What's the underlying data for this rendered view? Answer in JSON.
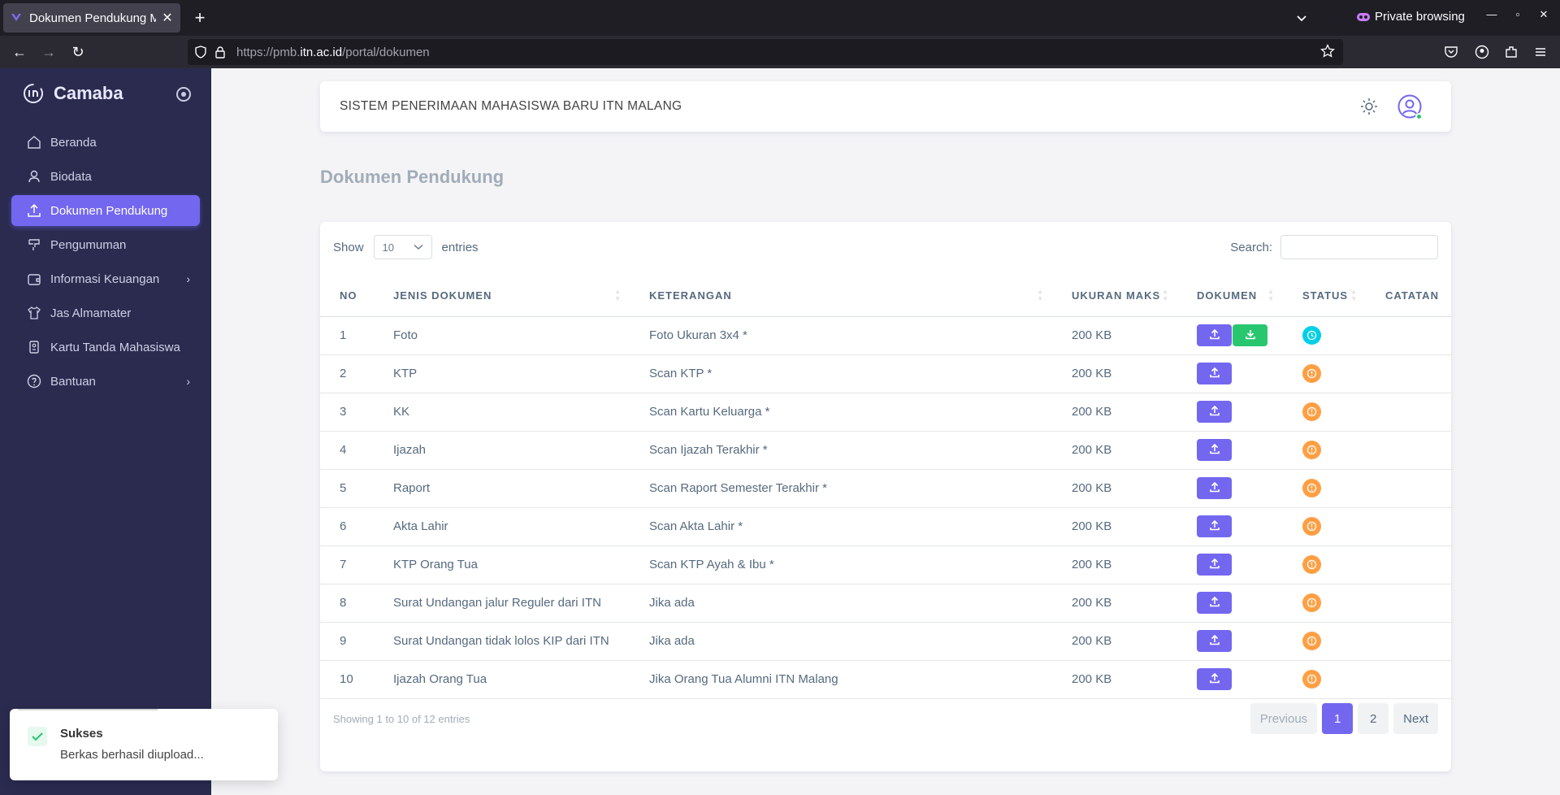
{
  "browser": {
    "tab_title": "Dokumen Pendukung Ma",
    "url_prefix": "https://pmb.",
    "url_domain": "itn.ac.id",
    "url_path": "/portal/dokumen",
    "private_label": "Private browsing"
  },
  "sidebar": {
    "brand": "Camaba",
    "items": [
      {
        "label": "Beranda",
        "icon": "home-icon"
      },
      {
        "label": "Biodata",
        "icon": "user-icon"
      },
      {
        "label": "Dokumen Pendukung",
        "icon": "upload-icon",
        "active": true
      },
      {
        "label": "Pengumuman",
        "icon": "megaphone-icon"
      },
      {
        "label": "Informasi Keuangan",
        "icon": "wallet-icon",
        "submenu": true
      },
      {
        "label": "Jas Almamater",
        "icon": "shirt-icon"
      },
      {
        "label": "Kartu Tanda Mahasiswa",
        "icon": "id-card-icon"
      },
      {
        "label": "Bantuan",
        "icon": "help-icon",
        "submenu": true
      }
    ]
  },
  "header": {
    "title": "SISTEM PENERIMAAN MAHASISWA BARU ITN MALANG"
  },
  "page": {
    "title": "Dokumen Pendukung"
  },
  "table_controls": {
    "show_label": "Show",
    "length_value": "10",
    "entries_label": "entries",
    "search_label": "Search:"
  },
  "table": {
    "headers": [
      "NO",
      "JENIS DOKUMEN",
      "KETERANGAN",
      "UKURAN MAKS",
      "DOKUMEN",
      "STATUS",
      "CATATAN"
    ],
    "rows": [
      {
        "no": "1",
        "jenis": "Foto",
        "ket": "Foto Ukuran 3x4 *",
        "size": "200 KB",
        "download": true,
        "status": "info"
      },
      {
        "no": "2",
        "jenis": "KTP",
        "ket": "Scan KTP *",
        "size": "200 KB",
        "download": false,
        "status": "warn"
      },
      {
        "no": "3",
        "jenis": "KK",
        "ket": "Scan Kartu Keluarga *",
        "size": "200 KB",
        "download": false,
        "status": "warn"
      },
      {
        "no": "4",
        "jenis": "Ijazah",
        "ket": "Scan Ijazah Terakhir *",
        "size": "200 KB",
        "download": false,
        "status": "warn"
      },
      {
        "no": "5",
        "jenis": "Raport",
        "ket": "Scan Raport Semester Terakhir *",
        "size": "200 KB",
        "download": false,
        "status": "warn"
      },
      {
        "no": "6",
        "jenis": "Akta Lahir",
        "ket": "Scan Akta Lahir *",
        "size": "200 KB",
        "download": false,
        "status": "warn"
      },
      {
        "no": "7",
        "jenis": "KTP Orang Tua",
        "ket": "Scan KTP Ayah & Ibu *",
        "size": "200 KB",
        "download": false,
        "status": "warn"
      },
      {
        "no": "8",
        "jenis": "Surat Undangan jalur Reguler dari ITN",
        "ket": "Jika ada",
        "size": "200 KB",
        "download": false,
        "status": "warn"
      },
      {
        "no": "9",
        "jenis": "Surat Undangan tidak lolos KIP dari ITN",
        "ket": "Jika ada",
        "size": "200 KB",
        "download": false,
        "status": "warn"
      },
      {
        "no": "10",
        "jenis": "Ijazah Orang Tua",
        "ket": "Jika Orang Tua Alumni ITN Malang",
        "size": "200 KB",
        "download": false,
        "status": "warn"
      }
    ]
  },
  "footer": {
    "info": "Showing 1 to 10 of 12 entries",
    "previous": "Previous",
    "pages": [
      "1",
      "2"
    ],
    "next": "Next"
  },
  "toast": {
    "title": "Sukses",
    "message": "Berkas berhasil diupload..."
  },
  "colors": {
    "primary": "#7367f0",
    "success": "#28c76f",
    "info": "#00cfe8",
    "warning": "#ff9f43",
    "sidebar": "#2a2b4f"
  }
}
